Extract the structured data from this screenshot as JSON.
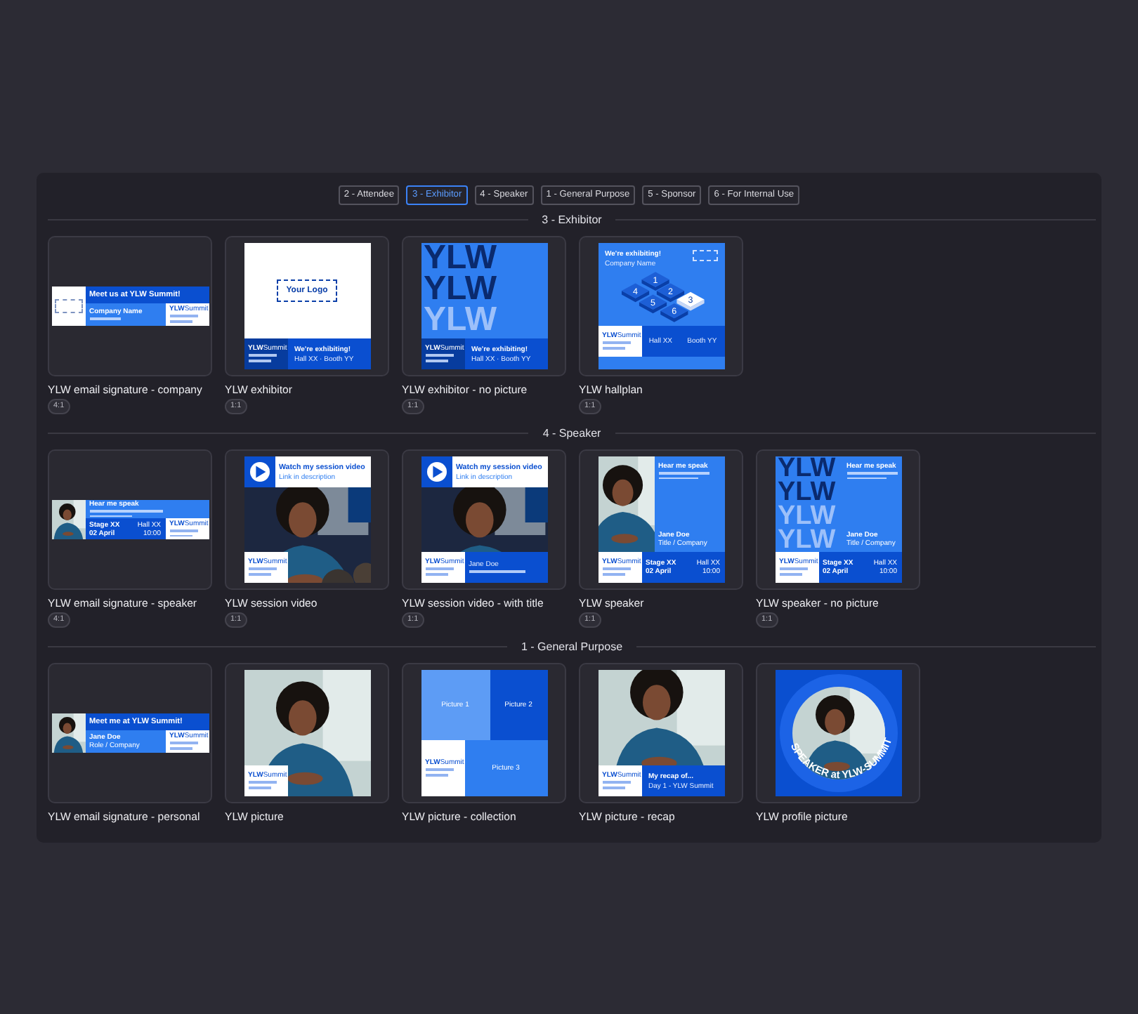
{
  "tabs": [
    {
      "label": "2 - Attendee",
      "selected": false
    },
    {
      "label": "3 - Exhibitor",
      "selected": true
    },
    {
      "label": "4 - Speaker",
      "selected": false
    },
    {
      "label": "1 - General Purpose",
      "selected": false
    },
    {
      "label": "5 - Sponsor",
      "selected": false
    },
    {
      "label": "6 - For Internal Use",
      "selected": false
    }
  ],
  "sections": [
    {
      "title": "3 - Exhibitor",
      "templates": [
        {
          "kind": "signature-company",
          "name": "YLW email signature - company",
          "ratio": "4:1",
          "texts": [
            "Meet us at YLW Summit!",
            "Company Name"
          ],
          "brand": {
            "logo": "**YLW**Summit"
          }
        },
        {
          "kind": "exhibitor",
          "name": "YLW exhibitor",
          "ratio": "1:1",
          "texts": [
            "Your Logo",
            "We're exhibiting!",
            "Hall XX · Booth YY"
          ],
          "brand": {
            "logo": "**YLW**Summit"
          }
        },
        {
          "kind": "exhibitor-no-picture",
          "name": "YLW exhibitor - no picture",
          "ratio": "1:1",
          "big": [
            "YLW",
            "YLW",
            "YLW"
          ],
          "texts": [
            "We're exhibiting!",
            "Hall XX · Booth YY"
          ],
          "brand": {
            "logo": "**YLW**Summit"
          }
        },
        {
          "kind": "hallplan",
          "name": "YLW hallplan",
          "ratio": "1:1",
          "texts": [
            "We're exhibiting!",
            "Company Name",
            "Hall XX",
            "Booth YY"
          ],
          "booths": [
            {
              "label": "1",
              "selected": false
            },
            {
              "label": "4",
              "selected": false
            },
            {
              "label": "2",
              "selected": false
            },
            {
              "label": "5",
              "selected": false
            },
            {
              "label": "3",
              "selected": true
            },
            {
              "label": "6",
              "selected": false
            }
          ],
          "brand": {
            "logo": "**YLW**Summit"
          }
        }
      ]
    },
    {
      "title": "4 - Speaker",
      "templates": [
        {
          "kind": "signature-speaker",
          "name": "YLW email signature - speaker",
          "ratio": "4:1",
          "texts": [
            "Hear me speak",
            "Stage XX",
            "Hall XX",
            "02 April",
            "10:00"
          ],
          "brand": {
            "logo": "**YLW**Summit"
          }
        },
        {
          "kind": "session-video",
          "name": "YLW session video",
          "ratio": "1:1",
          "texts": [
            "Watch my session video",
            "Link in description"
          ],
          "brand": {
            "logo": "**YLW**Summit"
          }
        },
        {
          "kind": "session-video-title",
          "name": "YLW session video - with title",
          "ratio": "1:1",
          "texts": [
            "Watch my session video",
            "Link in description",
            "Jane Doe"
          ],
          "brand": {
            "logo": "**YLW**Summit"
          }
        },
        {
          "kind": "speaker",
          "name": "YLW speaker",
          "ratio": "1:1",
          "texts": [
            "Hear me speak",
            "Jane Doe",
            "Title / Company",
            "Stage XX",
            "Hall XX",
            "02 April",
            "10:00"
          ],
          "brand": {
            "logo": "**YLW**Summit"
          }
        },
        {
          "kind": "speaker-no-picture",
          "name": "YLW speaker - no picture",
          "ratio": "1:1",
          "big": [
            "YLW",
            "YLW",
            "YLW",
            "YLW"
          ],
          "texts": [
            "Hear me speak",
            "Jane Doe",
            "Title / Company",
            "Stage XX",
            "Hall XX",
            "02 April",
            "10:00"
          ],
          "brand": {
            "logo": "**YLW**Summit"
          }
        }
      ]
    },
    {
      "title": "1 - General Purpose",
      "templates": [
        {
          "kind": "signature-personal",
          "name": "YLW email signature - personal",
          "texts": [
            "Meet me at YLW Summit!",
            "Jane Doe",
            "Role / Company"
          ],
          "brand": {
            "logo": "**YLW**Summit"
          }
        },
        {
          "kind": "picture",
          "name": "YLW picture",
          "brand": {
            "logo": "**YLW**Summit"
          }
        },
        {
          "kind": "collection",
          "name": "YLW picture - collection",
          "texts": [
            "Picture 1",
            "Picture 2",
            "Picture 3"
          ],
          "brand": {
            "logo": "**YLW**Summit"
          }
        },
        {
          "kind": "recap",
          "name": "YLW picture - recap",
          "texts": [
            "My recap of...",
            "Day 1 - YLW Summit"
          ],
          "brand": {
            "logo": "**YLW**Summit"
          }
        },
        {
          "kind": "profile",
          "name": "YLW profile picture",
          "texts": [
            "SPEAKER at YLW-SUMMIT"
          ]
        }
      ]
    }
  ]
}
